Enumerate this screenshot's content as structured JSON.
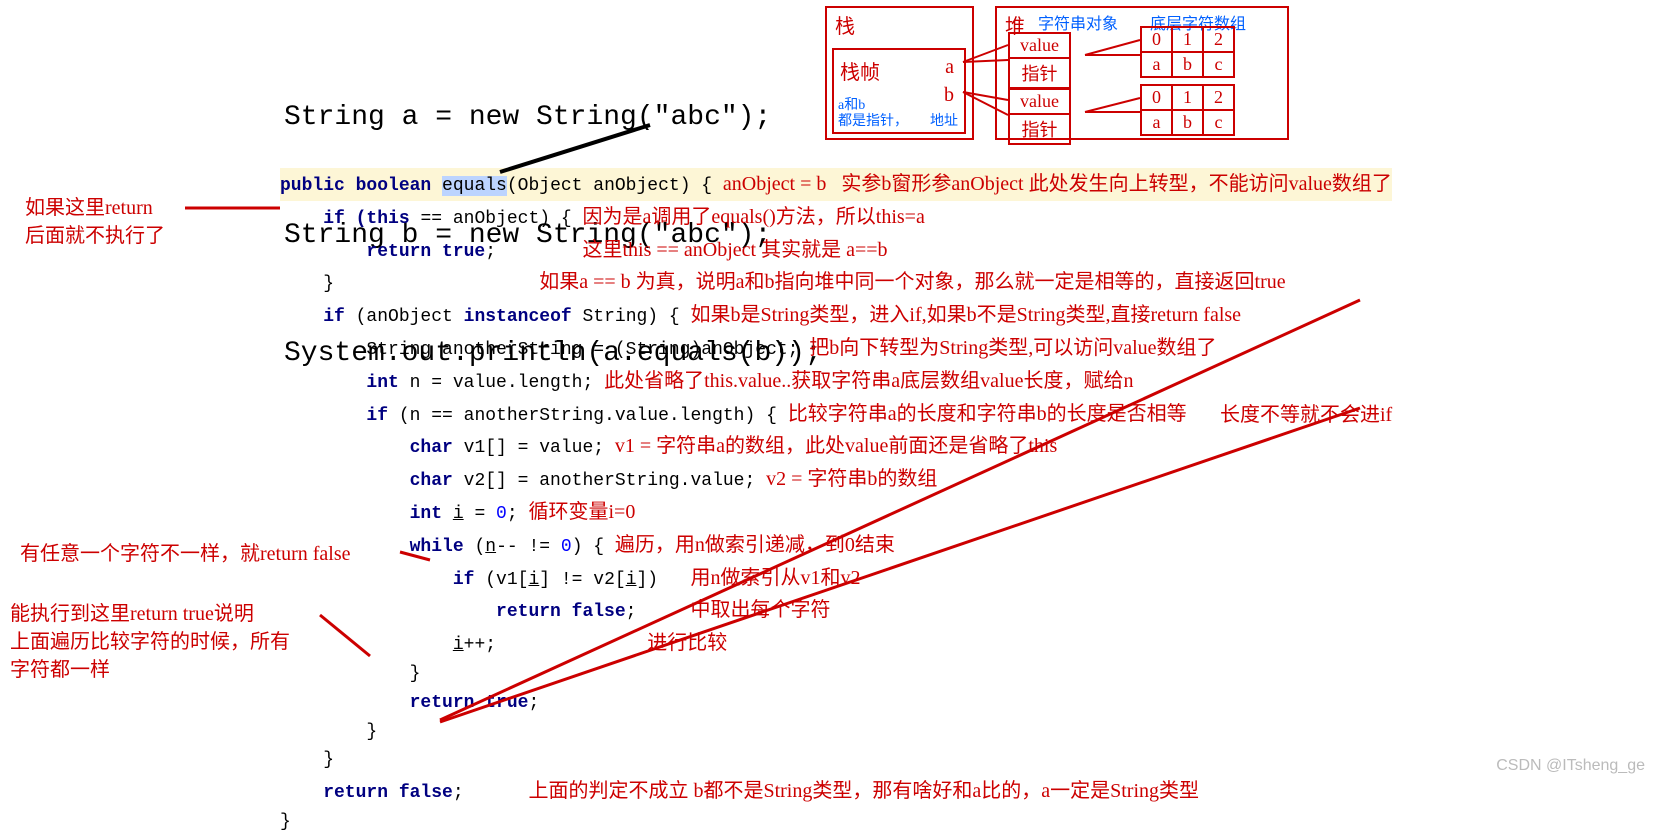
{
  "intro": {
    "line1": "String a = new String(\"abc\");",
    "line2": "String b = new String(\"abc\");",
    "line3": "System.out.println(a.equals(b));"
  },
  "mem": {
    "stack_title": "栈",
    "frame": "栈帧",
    "var_a": "a",
    "var_b": "b",
    "ab_note_l1": "a和b",
    "ab_note_l2": "都是指针，",
    "addr": "地址",
    "heap_title": "堆",
    "str_obj_label": "字符串对象",
    "arr_label": "底层字符数组",
    "value": "value",
    "pointer": "指针",
    "idx0": "0",
    "idx1": "1",
    "idx2": "2",
    "ch_a": "a",
    "ch_b": "b",
    "ch_c": "c"
  },
  "code": {
    "sig_public": "public ",
    "sig_boolean": "boolean ",
    "sig_equals": "equals",
    "sig_params": "(Object anObject)",
    "sig_brace": " {",
    "l2a": "    if ",
    "l2b": "(this ",
    "l2c": "== anObject) {",
    "l3": "        return true",
    "l3b": ";",
    "l4": "    }",
    "l5a": "    if ",
    "l5b": "(anObject ",
    "l5c": "instanceof ",
    "l5d": "String) {",
    "l6": "        String anotherString = (String)anObject;",
    "l7a": "        int ",
    "l7b": "n = value.length;",
    "l8a": "        if ",
    "l8b": "(n == anotherString.value.length) {",
    "l9a": "            char ",
    "l9b": "v1[] = value;",
    "l10a": "            char ",
    "l10b": "v2[] = anotherString.value;",
    "l11a": "            int ",
    "l11b": "i",
    "l11c": " = ",
    "l11d": "0",
    "l11e": ";",
    "l12a": "            while ",
    "l12b": "(",
    "l12c": "n",
    "l12d": "-- != ",
    "l12e": "0",
    "l12f": ") {",
    "l13a": "                if ",
    "l13b": "(v1[",
    "l13c": "i",
    "l13d": "] != v2[",
    "l13e": "i",
    "l13f": "])",
    "l14": "                    return false",
    "l14b": ";",
    "l15a": "                ",
    "l15b": "i",
    "l15c": "++;",
    "l16": "            }",
    "l17": "            return true",
    "l17b": ";",
    "l18": "        }",
    "l19": "    }",
    "l20": "    return false",
    "l20b": ";",
    "l21": "}"
  },
  "ann": {
    "a1": "anObject = b   实参b窗形参anObject 此处发生向上转型，不能访问value数组了",
    "a2": "因为是a调用了equals()方法，所以this=a",
    "a3": "这里this == anObject 其实就是 a==b",
    "a4": "如果a == b 为真，说明a和b指向堆中同一个对象，那么就一定是相等的，直接返回true",
    "a5": "如果b是String类型，进入if,如果b不是String类型,直接return false",
    "a6": "把b向下转型为String类型,可以访问value数组了",
    "a7": "此处省略了this.value..获取字符串a底层数组value长度，赋给n",
    "a8": "比较字符串a的长度和字符串b的长度是否相等",
    "a9": "v1 = 字符串a的数组，此处value前面还是省略了this",
    "a10": "v2 = 字符串b的数组",
    "a11": "循环变量i=0",
    "a12": "遍历，用n做索引递减，到0结束",
    "a13a": "用n做索引从v1和v2",
    "a13b": "中取出每个字符",
    "a13c": "进行比较",
    "a14": "长度不等就不会进if",
    "a15": "上面的判定不成立 b都不是String类型，那有啥好和a比的，a一定是String类型",
    "left1a": "如果这里return",
    "left1b": "后面就不执行了",
    "left2": "有任意一个字符不一样，就return false",
    "left3a": "能执行到这里return true说明",
    "left3b": "上面遍历比较字符的时候，所有",
    "left3c": "字符都一样"
  },
  "watermark": "CSDN @ITsheng_ge"
}
